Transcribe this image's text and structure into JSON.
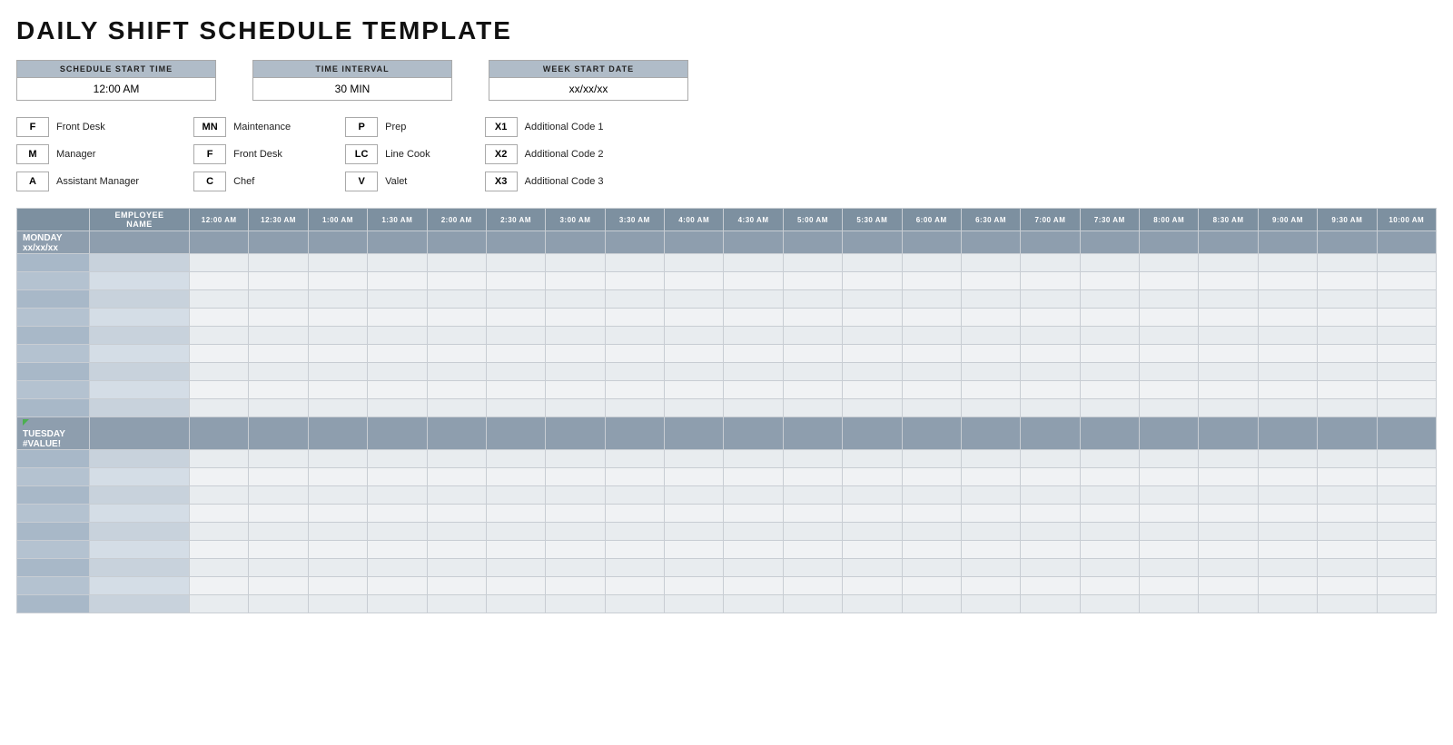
{
  "title": "DAILY SHIFT SCHEDULE TEMPLATE",
  "controls": [
    {
      "id": "schedule-start-time",
      "label": "SCHEDULE START TIME",
      "value": "12:00 AM"
    },
    {
      "id": "time-interval",
      "label": "TIME INTERVAL",
      "value": "30 MIN"
    },
    {
      "id": "week-start-date",
      "label": "WEEK START DATE",
      "value": "xx/xx/xx"
    }
  ],
  "legend": [
    [
      {
        "code": "F",
        "name": "Front Desk"
      },
      {
        "code": "M",
        "name": "Manager"
      },
      {
        "code": "A",
        "name": "Assistant Manager"
      }
    ],
    [
      {
        "code": "MN",
        "name": "Maintenance"
      },
      {
        "code": "F",
        "name": "Front Desk"
      },
      {
        "code": "C",
        "name": "Chef"
      }
    ],
    [
      {
        "code": "P",
        "name": "Prep"
      },
      {
        "code": "LC",
        "name": "Line Cook"
      },
      {
        "code": "V",
        "name": "Valet"
      }
    ],
    [
      {
        "code": "X1",
        "name": "Additional Code 1"
      },
      {
        "code": "X2",
        "name": "Additional Code 2"
      },
      {
        "code": "X3",
        "name": "Additional Code 3"
      }
    ]
  ],
  "time_slots": [
    "12:00 AM",
    "12:30 AM",
    "1:00 AM",
    "1:30 AM",
    "2:00 AM",
    "2:30 AM",
    "3:00 AM",
    "3:30 AM",
    "4:00 AM",
    "4:30 AM",
    "5:00 AM",
    "5:30 AM",
    "6:00 AM",
    "6:30 AM",
    "7:00 AM",
    "7:30 AM",
    "8:00 AM",
    "8:30 AM",
    "9:00 AM",
    "9:30 AM",
    "10:00 AM"
  ],
  "days": [
    {
      "name": "MONDAY",
      "date": "xx/xx/xx",
      "rows": 9
    },
    {
      "name": "TUESDAY",
      "date": "#VALUE!",
      "rows": 9,
      "has_indicator": true
    }
  ],
  "employee_header": "EMPLOYEE NAME"
}
